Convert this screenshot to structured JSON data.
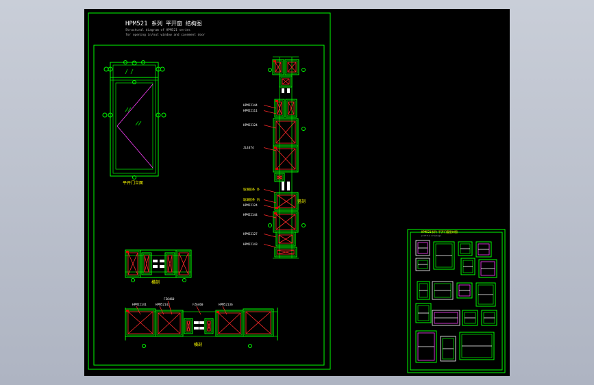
{
  "drawing": {
    "series_title": "HPM521",
    "title_cn": "系列 平开窗 结构图",
    "subtitle_line1": "Structural diagram of HPM521 series",
    "subtitle_line2": "for opening in/out window and casement door"
  },
  "elevation": {
    "caption": "平开门立面"
  },
  "section_labels": {
    "vertical": "竖剖",
    "small_horizontal": "横剖",
    "large_horizontal": "横剖"
  },
  "callouts_vertical": [
    "HPM52144",
    "HPM52111",
    "HPM52124",
    "JL4474",
    "玻璃胶条 外",
    "玻璃胶条 内",
    "HPM52124",
    "HPM52144",
    "HPM52127",
    "HPM52143"
  ],
  "callouts_horizontal": [
    "HPM52141",
    "HPM52143",
    "FZ6460",
    "FZ6460",
    "HPM52136"
  ],
  "profile_sheet": {
    "title": "HPM521系列 平开门窗型材图",
    "subtitle": "profile drawings"
  },
  "colors": {
    "background": "#000000",
    "linework": "#00ff00",
    "glass": "#ff40ff",
    "profile_fill": "#e00000",
    "text": "#ffffff",
    "labels": "#ffff00"
  }
}
